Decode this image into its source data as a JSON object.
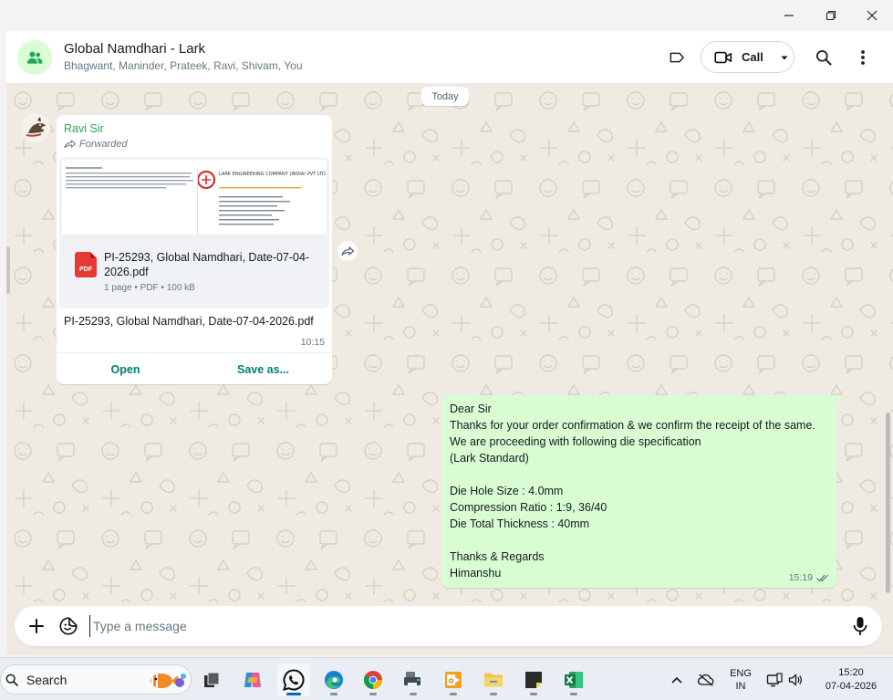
{
  "chat": {
    "title": "Global Namdhari - Lark",
    "participants": "Bhagwant, Maninder, Prateek, Ravi, Shivam, You",
    "call_label": "Call"
  },
  "day_divider": "Today",
  "incoming_message": {
    "sender": "Ravi Sir",
    "forwarded_label": "Forwarded",
    "document": {
      "file_name": "PI-25293, Global Namdhari, Date-07-04-2026.pdf",
      "meta": "1 page • PDF • 100 kB",
      "icon_label": "PDF",
      "preview_company": "LARK ENGINEERING COMPANY (INDIA) PVT LTD"
    },
    "caption": "PI-25293, Global Namdhari, Date-07-04-2026.pdf",
    "time": "10:15",
    "open_label": "Open",
    "save_label": "Save as..."
  },
  "outgoing_message": {
    "text": "Dear Sir\nThanks for your order confirmation & we confirm the receipt of the same.\nWe are proceeding with following die specification\n(Lark Standard)\n\nDie Hole Size : 4.0mm\nCompression Ratio : 1:9, 36/40\nDie Total Thickness : 40mm\n\nThanks & Regards\nHimanshu",
    "time": "15:19",
    "status": "read"
  },
  "composer": {
    "placeholder": "Type a message"
  },
  "taskbar": {
    "search_label": "Search",
    "language_line1": "ENG",
    "language_line2": "IN",
    "time": "15:20",
    "date": "07-04-2026"
  },
  "colors": {
    "accent_green": "#008069",
    "sender_name": "#1fa855",
    "outgoing_bubble": "#d9fdd3",
    "chat_background": "#efeae2",
    "read_ticks": "#667781"
  }
}
